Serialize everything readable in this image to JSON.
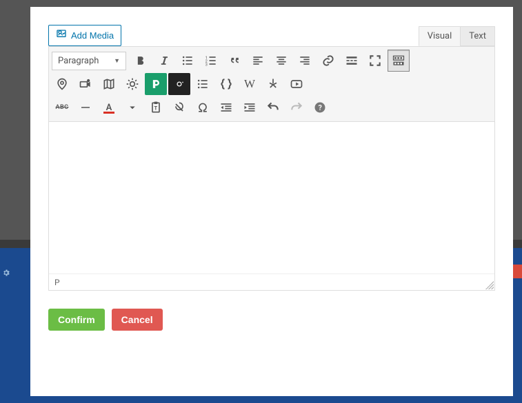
{
  "add_media_label": "Add Media",
  "tabs": {
    "visual": "Visual",
    "text": "Text"
  },
  "format_select": "Paragraph",
  "statusbar_path": "P",
  "buttons": {
    "confirm": "Confirm",
    "cancel": "Cancel"
  },
  "wikipedia_glyph": "W",
  "abc_label": "ABC",
  "textcolor_letter": "A"
}
